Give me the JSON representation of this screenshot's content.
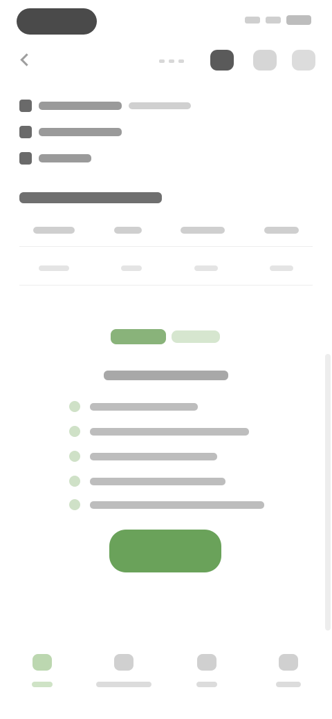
{
  "status_bar": {
    "time": "",
    "indicators": [
      "signal-icon",
      "wifi-icon",
      "battery-icon"
    ]
  },
  "toolbar": {
    "icons": [
      "back-icon",
      "share-icon",
      "bookmark-icon",
      "more-icon"
    ]
  },
  "details": {
    "items": [
      {
        "icon": "location-icon",
        "text": ""
      },
      {
        "icon": "calendar-icon",
        "text": ""
      },
      {
        "icon": "user-icon",
        "text": ""
      }
    ]
  },
  "section": {
    "title": ""
  },
  "table": {
    "headers": [
      "",
      "",
      "",
      ""
    ],
    "row": [
      "",
      "",
      "",
      ""
    ]
  },
  "promo": {
    "brand": "",
    "subtitle": "",
    "features": [
      "",
      "",
      "",
      "",
      ""
    ],
    "cta_label": ""
  },
  "bottom_nav": {
    "items": [
      {
        "icon": "home-icon",
        "label": "",
        "active": true
      },
      {
        "icon": "explore-icon",
        "label": "",
        "active": false
      },
      {
        "icon": "bookmark-icon",
        "label": "",
        "active": false
      },
      {
        "icon": "profile-icon",
        "label": "",
        "active": false
      }
    ]
  },
  "colors": {
    "accent": "#6aa25a",
    "accent_light": "#cfe1c7",
    "text_dark": "#5a5a5a"
  }
}
